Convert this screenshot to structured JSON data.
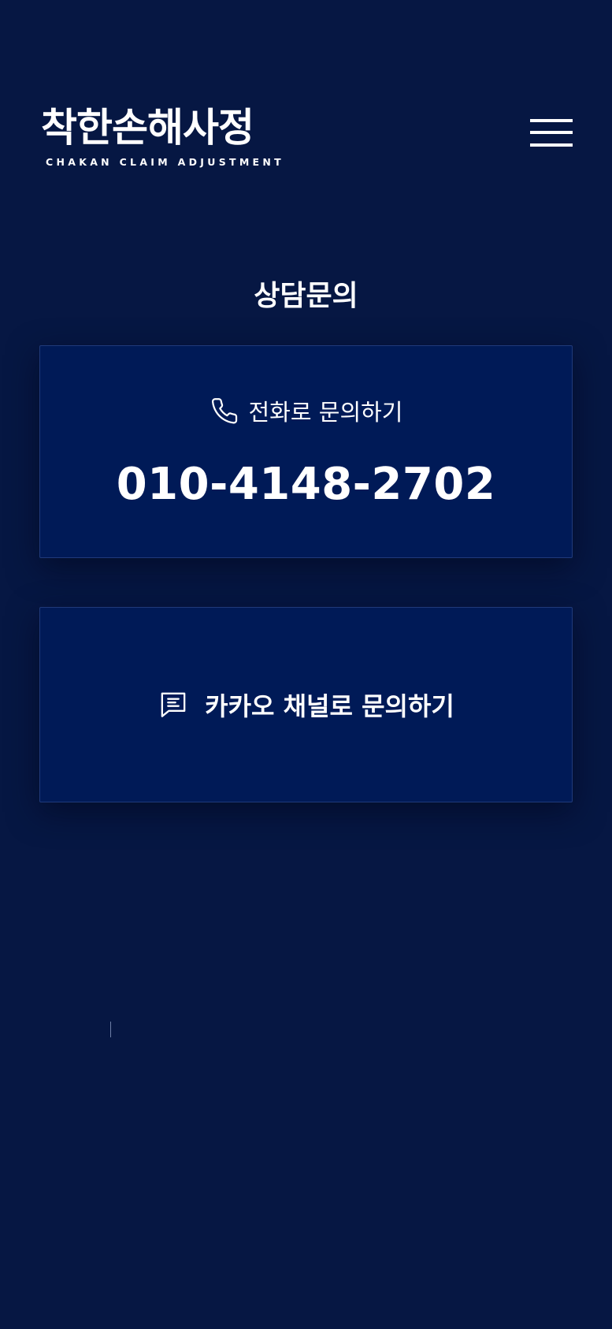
{
  "header": {
    "logo": {
      "wordmark": "착한손해사정",
      "subtitle": "CHAKAN CLAIM ADJUSTMENT"
    },
    "menu_icon": "hamburger-menu-icon"
  },
  "main": {
    "section_title": "상담문의",
    "phone_card": {
      "icon": "phone-icon",
      "label": "전화로 문의하기",
      "number": "010-4148-2702"
    },
    "kakao_card": {
      "icon": "chat-bubble-icon",
      "label": "카카오 채널로 문의하기"
    }
  },
  "colors": {
    "background": "#061743",
    "card_background": "#001a57",
    "card_border": "#203a7a",
    "text": "#ffffff"
  }
}
